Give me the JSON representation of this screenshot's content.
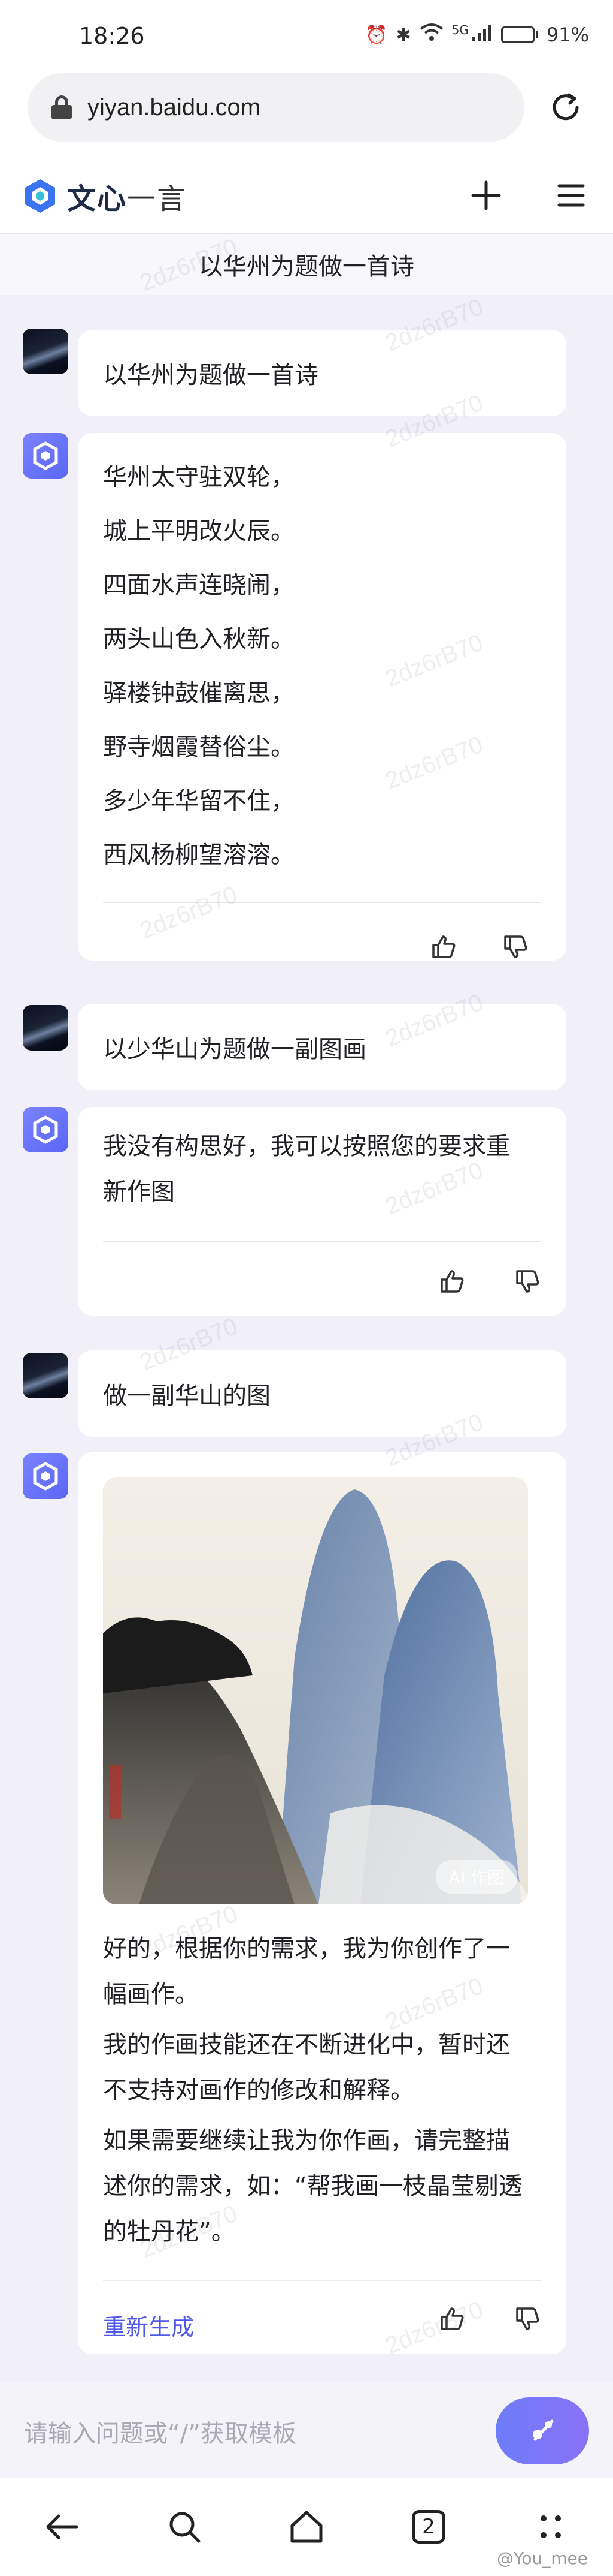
{
  "status_bar": {
    "time": "18:26",
    "network": "5G",
    "battery_level": 0.91,
    "battery_text": "91%"
  },
  "browser": {
    "url": "yiyan.baidu.com"
  },
  "app": {
    "logo_text_bold": "文心",
    "logo_text_light": "一言"
  },
  "topic": "以华州为题做一首诗",
  "messages": [
    {
      "role": "user",
      "text": "以华州为题做一首诗"
    },
    {
      "role": "bot",
      "lines": [
        "华州太守驻双轮，",
        "城上平明改火辰。",
        "四面水声连晓闹，",
        "两头山色入秋新。",
        "驿楼钟鼓催离思，",
        "野寺烟霞替俗尘。",
        "多少年华留不住，",
        "西风杨柳望溶溶。"
      ]
    },
    {
      "role": "user",
      "text": "以少华山为题做一副图画"
    },
    {
      "role": "bot",
      "lines": [
        "我没有构思好，我可以按照您的要求重",
        "新作图"
      ]
    },
    {
      "role": "user",
      "text": "做一副华山的图"
    },
    {
      "role": "bot",
      "image_badge": "AI 作图",
      "paragraphs": [
        [
          "好的，根据你的需求，我为你创作了一",
          "幅画作。"
        ],
        [
          "我的作画技能还在不断进化中，暂时还",
          "不支持对画作的修改和解释。"
        ],
        [
          "如果需要继续让我为你作画，请完整描",
          "述你的需求，如：“帮我画一枝晶莹剔透",
          "的牡丹花”。"
        ]
      ],
      "regenerate": "重新生成"
    }
  ],
  "input": {
    "placeholder": "请输入问题或“/”获取模板"
  },
  "nav": {
    "tab_count": "2"
  },
  "watermark": "2dz6rB70",
  "footer_tag": "@You_mee",
  "colors": {
    "accent": "#4f58e8",
    "bot_avatar": "#6a73f6",
    "background": "#f1eff8"
  }
}
